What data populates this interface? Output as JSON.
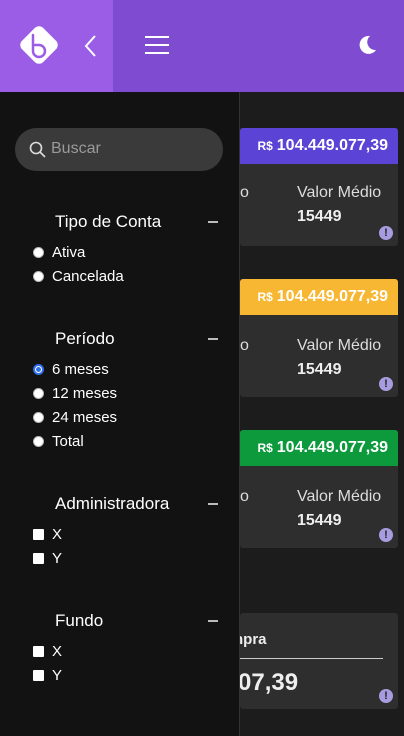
{
  "header": {
    "logo_icon": "logo-b",
    "back_icon": "chevron-left",
    "menu_icon": "hamburger",
    "theme_icon": "moon"
  },
  "search": {
    "placeholder": "Buscar"
  },
  "filters": {
    "tipo_conta": {
      "title": "Tipo de Conta",
      "options": [
        "Ativa",
        "Cancelada"
      ]
    },
    "periodo": {
      "title": "Período",
      "options": [
        "6 meses",
        "12 meses",
        "24 meses",
        "Total"
      ],
      "selected": "6 meses"
    },
    "administradora": {
      "title": "Administradora",
      "options": [
        "X",
        "Y"
      ]
    },
    "fundo": {
      "title": "Fundo",
      "options": [
        "X",
        "Y"
      ]
    }
  },
  "cards": [
    {
      "currency": "R$",
      "amount": "104.449.077,39",
      "partial_label": "o",
      "label": "Valor Médio",
      "value": "15449",
      "color": "#5b43d6"
    },
    {
      "currency": "R$",
      "amount": "104.449.077,39",
      "partial_label": "o",
      "label": "Valor Médio",
      "value": "15449",
      "color": "#f7b733"
    },
    {
      "currency": "R$",
      "amount": "104.449.077,39",
      "partial_label": "o",
      "label": "Valor Médio",
      "value": "15449",
      "color": "#0c9a3c"
    }
  ],
  "bottom_card": {
    "label": "npra",
    "value": "07,39"
  }
}
